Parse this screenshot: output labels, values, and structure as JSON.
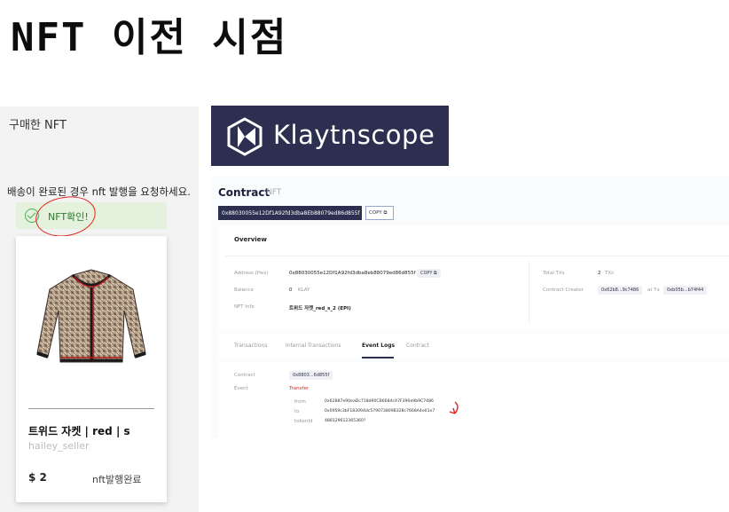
{
  "slide": {
    "title": "NFT 이전 시점"
  },
  "shop": {
    "heading": "구매한 NFT",
    "instruction": "배송이 완료된 경우 nft 발행을 요청하세요.",
    "nft_check_label": "NFT확인!",
    "product": {
      "name": "트위드 자켓 | red | s",
      "seller": "hailey_seller",
      "price": "$ 2",
      "status": "nft발행완료"
    }
  },
  "klaytnscope": {
    "brand": "Klaytnscope",
    "contract_title": "Contract",
    "contract_type": "NFT",
    "address": "0x88030055e12Df1A92fd3dba8Eb88079ed86d855f",
    "copy_label": "COPY",
    "overview": {
      "title": "Overview",
      "address_label": "Address (Hex)",
      "address_value": "0x88030055e12Df1A92fd3dba8eb88079ed86d855f",
      "copy_label": "COPY",
      "balance_label": "Balance",
      "balance_value": "0",
      "balance_unit": "KLAY",
      "nft_info_label": "NFT Info",
      "nft_info_value": "트위드 자켓_red_s_2 (EPI)",
      "total_txs_label": "Total TXs",
      "total_txs_value": "2",
      "total_txs_unit": "TXs",
      "creator_label": "Contract Creator",
      "creator_address": "0x62b8...9c7486",
      "creator_at_tx": "at Tx",
      "creator_tx": "0xb05b...b74f44"
    },
    "tabs": [
      "Transactions",
      "Internal Transactions",
      "Event Logs",
      "Contract"
    ],
    "active_tab": "Event Logs",
    "event": {
      "contract_label": "Contract",
      "contract_value": "0x8803...6d855f",
      "event_label": "Event",
      "event_name": "Transfer",
      "from_label": "from",
      "from_value": "0x62B87e90eaDc718d90CB6684cA7F390e9b9C7486",
      "to_label": "to",
      "to_value": "0x0959c3bF183094dc579073809B328c7668A4e01e7",
      "tokenid_label": "tokenId",
      "tokenid_value": "488129612365360?"
    }
  },
  "colors": {
    "klaytn_navy": "#2c2f4f",
    "annotation_red": "#e0261b",
    "success_green": "#4caf50"
  },
  "icons": [
    "check-circle-icon",
    "copy-icon",
    "klaytn-logo-icon"
  ]
}
